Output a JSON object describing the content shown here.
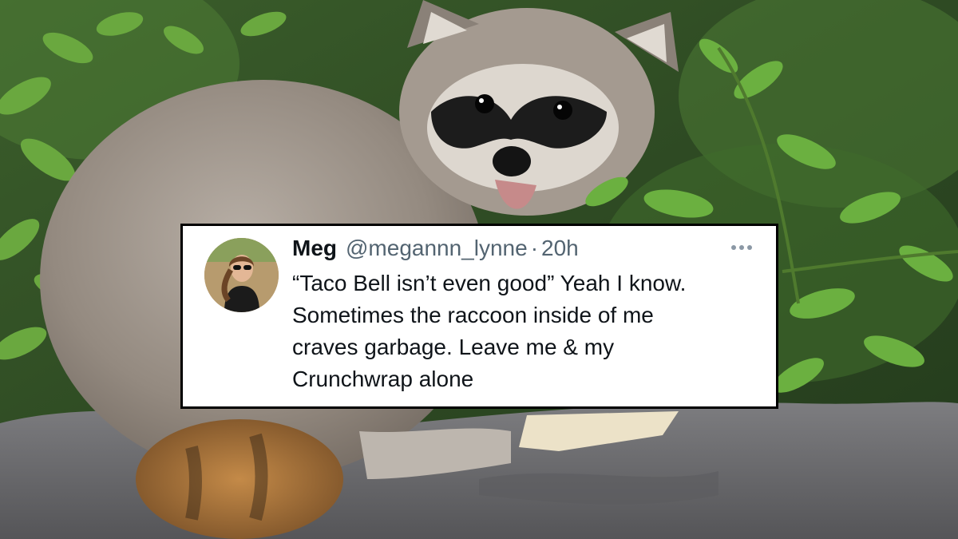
{
  "background": {
    "subject": "raccoon on rock with green leaves",
    "colors": {
      "fur": "#9a9088",
      "mask": "#202020",
      "rock": "#6e6e70",
      "leaves": "#5f9a38",
      "tail": "#b07a3e"
    }
  },
  "tweet": {
    "author_name": "Meg",
    "handle": "@megannn_lynne",
    "separator": "·",
    "time": "20h",
    "more_icon": "more-horizontal-icon",
    "avatar_icon": "profile-photo",
    "text_lines": [
      "“Taco Bell isn’t even good” Yeah I know.",
      "Sometimes the raccoon inside of me",
      "craves garbage. Leave me & my",
      "Crunchwrap alone"
    ]
  },
  "colors": {
    "card_bg": "#ffffff",
    "card_border": "#000000",
    "text": "#0f1419",
    "muted": "#536471"
  }
}
